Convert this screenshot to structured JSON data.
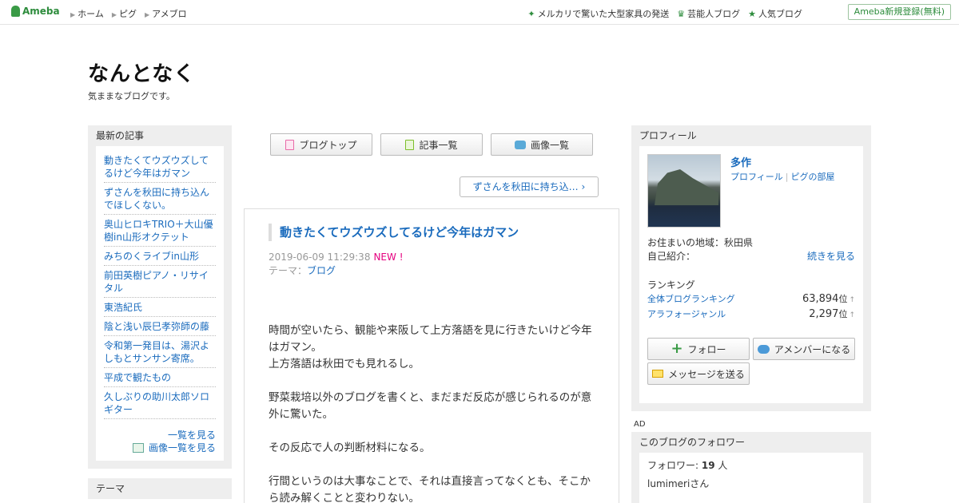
{
  "topbar": {
    "logo": "Ameba",
    "nav": [
      "ホーム",
      "ピグ",
      "アメブロ"
    ],
    "right_links": [
      "メルカリで驚いた大型家具の発送",
      "芸能人ブログ",
      "人気ブログ"
    ],
    "register": "Ameba新規登録(無料)"
  },
  "blog": {
    "title": "なんとなく",
    "description": "気ままなブログです。"
  },
  "recent": {
    "heading": "最新の記事",
    "items": [
      "動きたくてウズウズしてるけど今年はガマン",
      "ずさんを秋田に持ち込んでほしくない。",
      "奥山ヒロキTRIO＋大山優樹in山形オクテット",
      "みちのくライブin山形",
      "前田英樹ピアノ・リサイタル",
      "東浩紀氏",
      "陰と浅い辰巳孝弥師の藤",
      "令和第一発目は、湯沢よしもとサンサン寄席。",
      "平成で観たもの",
      "久しぶりの助川太郎ソロギター"
    ],
    "list_all": "一覧を見る",
    "image_list": "画像一覧を見る"
  },
  "theme": {
    "heading": "テーマ"
  },
  "center_nav": {
    "blog_top": "ブログトップ",
    "articles": "記事一覧",
    "images": "画像一覧"
  },
  "prev_article": "ずさんを秋田に持ち込…",
  "article": {
    "title": "動きたくてウズウズしてるけど今年はガマン",
    "date": "2019-06-09 11:29:38",
    "new_badge": "NEW !",
    "theme_label": "テーマ：",
    "theme": "ブログ",
    "paragraphs": [
      "時間が空いたら、観能や来阪して上方落語を見に行きたいけど今年はガマン。",
      "上方落語は秋田でも見れるし。",
      "野菜栽培以外のブログを書くと、まだまだ反応が感じられるのが意外に驚いた。",
      "その反応で人の判断材料になる。",
      "行間というのは大事なことで、それは直接言ってなくとも、そこから読み解くことと変わりない。"
    ]
  },
  "profile": {
    "heading": "プロフィール",
    "name": "多作",
    "profile_link": "プロフィール",
    "pig_link": "ピグの部屋",
    "location": "お住まいの地域：秋田県",
    "self_intro": "自己紹介：",
    "read_more": "続きを見る",
    "ranking_heading": "ランキング",
    "rankings": [
      {
        "label": "全体ブログランキング",
        "value": "63,894",
        "unit": "位",
        "arrow": "↑"
      },
      {
        "label": "アラフォージャンル",
        "value": "2,297",
        "unit": "位",
        "arrow": "↑"
      }
    ],
    "follow_button": "フォロー",
    "amember_button": "アメンバーになる",
    "message_button": "メッセージを送る"
  },
  "ad_label": "AD",
  "followers": {
    "heading": "このブログのフォロワー",
    "count_label": "フォロワー: ",
    "count": "19",
    "count_unit": " 人",
    "first_name": "lumimeriさん"
  }
}
